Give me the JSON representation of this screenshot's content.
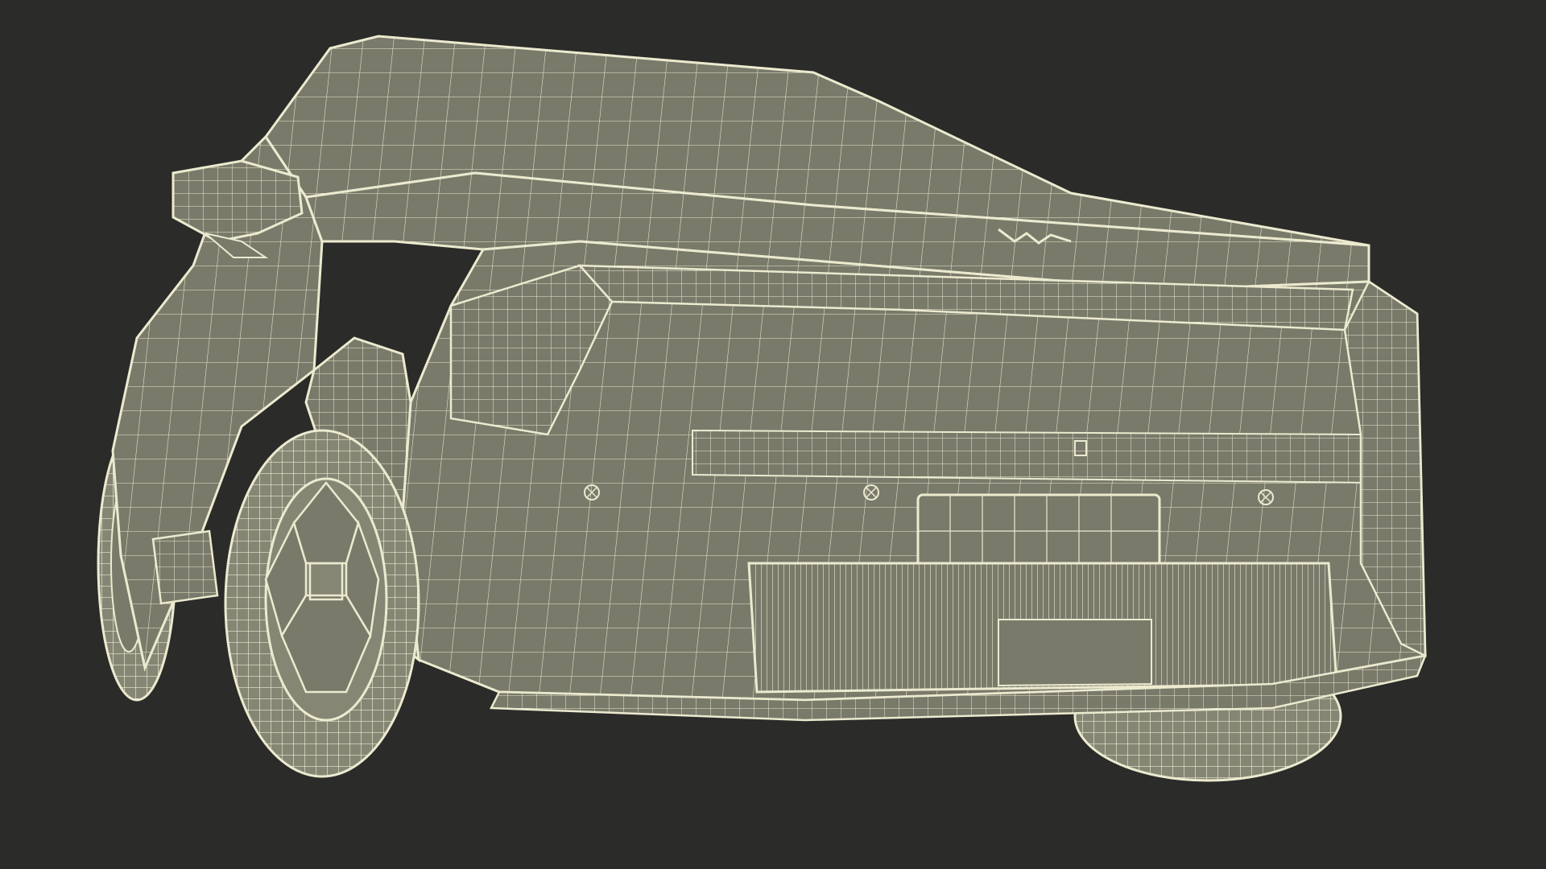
{
  "scene": {
    "subject": "suv-wireframe-front-three-quarter",
    "colors": {
      "background": "#2b2b29",
      "surface": "#7a7a6b",
      "surface_dark": "#6c6c5e",
      "wire": "#eceacf",
      "tire": "#868675"
    }
  }
}
